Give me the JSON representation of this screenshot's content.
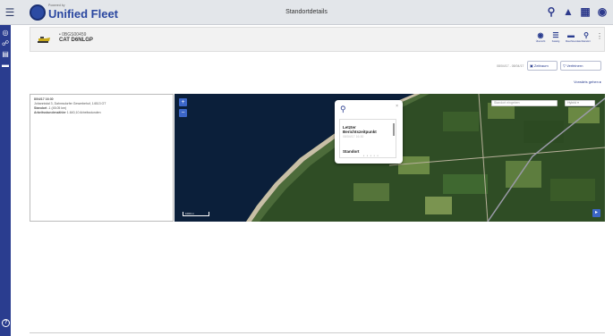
{
  "header": {
    "menu_icon": "hamburger-icon",
    "brand_subtitle": "Powered by",
    "brand_title": "Unified Fleet",
    "page_title": "Standortdetails",
    "icons": [
      "search-icon",
      "alert-icon",
      "grid-icon",
      "account-icon"
    ]
  },
  "sidebar": {
    "icons": [
      "location-icon",
      "team-icon",
      "document-icon",
      "card-icon"
    ],
    "help_icon": "help-icon"
  },
  "asset": {
    "id": "• 0BGS00459",
    "name": "CAT D6NLGP",
    "actions": [
      {
        "label": "Übersicht",
        "icon": "overview-icon"
      },
      {
        "label": "Katalog",
        "icon": "list-icon"
      },
      {
        "label": "Maschinendaten",
        "icon": "machine-data-icon"
      },
      {
        "label": "Standort",
        "icon": "location-pin-icon"
      }
    ]
  },
  "filters": {
    "date_range": "08/04/17 - 08/04/17",
    "zeitraum_label": "Zeitraum",
    "verfeinern_label": "Verfeinern",
    "next_label": "Vorwärts gehen"
  },
  "info": {
    "timestamp": "8/04/17 16:30",
    "address": "Johannistal 3, Dahmsdorfer Gewerbehof, 14513 GT",
    "status_label": "Standort",
    "status_value": "-1 (45.05 km)",
    "hours_label": "Arbeitsstundenzähler",
    "hours_value": "1.640,10 Arbeitsstunden"
  },
  "map": {
    "zoom_in": "+",
    "zoom_out": "−",
    "scale_label": "1000 m",
    "search_placeholder": "Standort eingeben",
    "map_type": "Hybrid",
    "popup_title_1": "Letzter",
    "popup_title_2": "Berichtszeitpunkt",
    "popup_sub": "08/04/17 16:30",
    "popup_title_3": "Standort"
  }
}
